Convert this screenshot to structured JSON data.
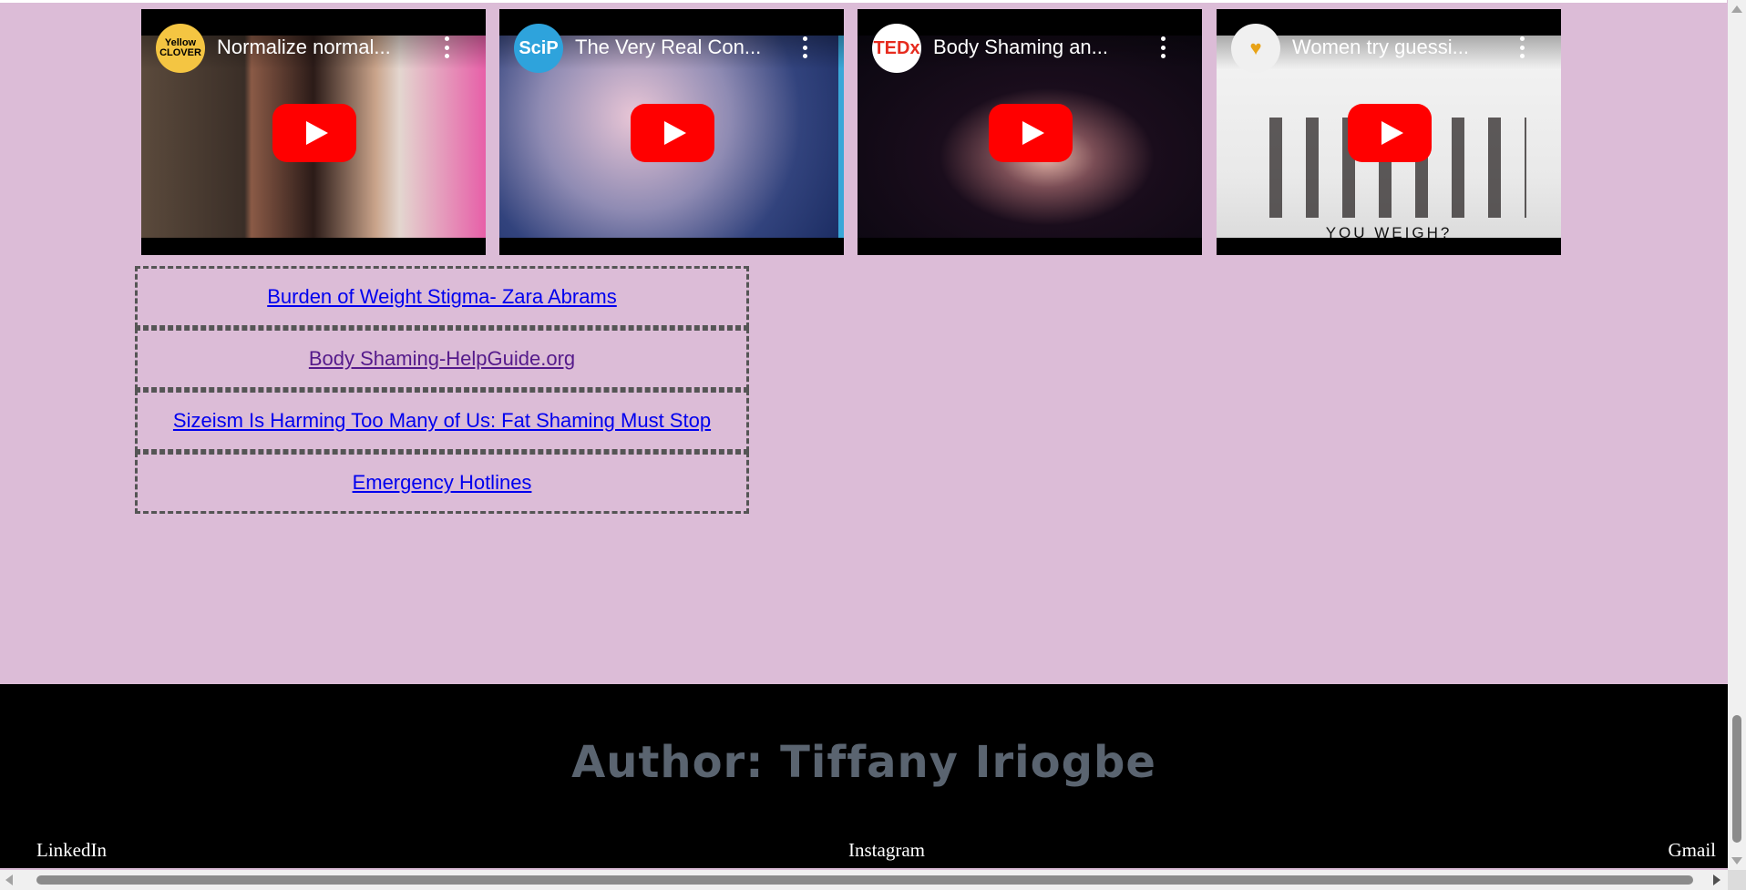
{
  "videos": [
    {
      "title": "Normalize normal...",
      "channel": "Yellow CLOVER",
      "icon": "youtube-play-icon"
    },
    {
      "title": "The Very Real Con...",
      "channel": "SciP",
      "icon": "youtube-play-icon"
    },
    {
      "title": "Body Shaming an...",
      "channel": "TEDx",
      "icon": "youtube-play-icon"
    },
    {
      "title": "Women try guessi...",
      "channel": "",
      "thumb_text": "YOU WEIGH?",
      "icon": "youtube-play-icon"
    }
  ],
  "links": [
    {
      "label": "Burden of Weight Stigma- Zara Abrams"
    },
    {
      "label": "Body Shaming-HelpGuide.org"
    },
    {
      "label": "Sizeism Is Harming Too Many of Us: Fat Shaming Must Stop"
    },
    {
      "label": "Emergency Hotlines"
    }
  ],
  "footer": {
    "author": "Author: Tiffany Iriogbe",
    "linkedin": "LinkedIn",
    "instagram": "Instagram",
    "gmail": "Gmail"
  },
  "colors": {
    "page_background": "#dcbcd7",
    "footer_background": "#000000",
    "link": "#0000ee",
    "visited_link": "#551a8b",
    "play_button": "#ff0000"
  }
}
